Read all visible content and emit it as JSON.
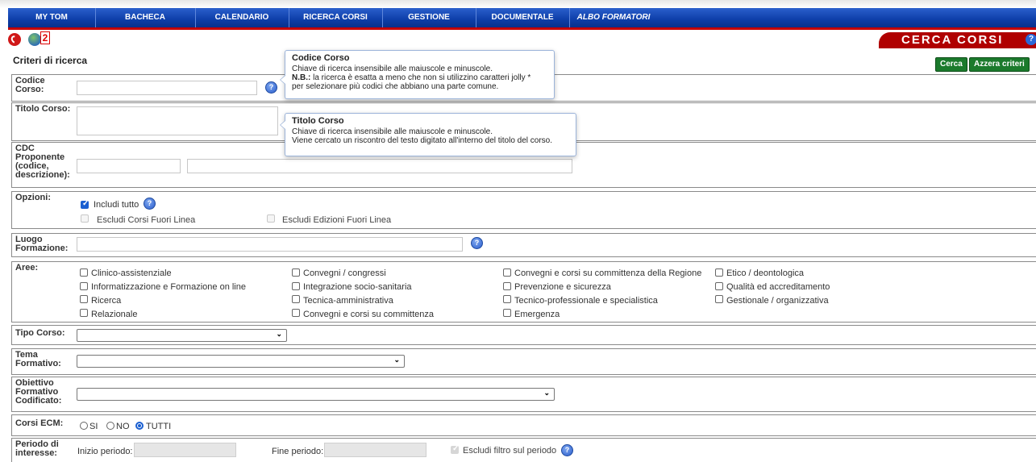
{
  "nav": {
    "items": [
      "MY TOM",
      "BACHECA",
      "CALENDARIO",
      "RICERCA CORSI",
      "GESTIONE",
      "DOCUMENTALE",
      "ALBO FORMATORI"
    ]
  },
  "header": {
    "notification_count": "2",
    "page_title": "CERCA CORSI",
    "section_title": "Criteri di ricerca",
    "search_label": "Cerca",
    "reset_label": "Azzera criteri"
  },
  "fields": {
    "codice": {
      "label": "Codice Corso:",
      "value": ""
    },
    "titolo": {
      "label": "Titolo Corso:",
      "value": ""
    },
    "cdc": {
      "label": "CDC Proponente (codice, descrizione):",
      "code_value": "",
      "desc_value": ""
    },
    "opzioni": {
      "label": "Opzioni:",
      "includi_tutto": "Includi tutto",
      "escludi_corsi": "Escludi Corsi Fuori Linea",
      "escludi_edizioni": "Escludi Edizioni Fuori Linea"
    },
    "luogo": {
      "label": "Luogo Formazione:",
      "value": ""
    },
    "aree": {
      "label": "Aree:",
      "items": [
        "Clinico-assistenziale",
        "Convegni / congressi",
        "Convegni e corsi su committenza della Regione",
        "Etico / deontologica",
        "Informatizzazione e Formazione on line",
        "Integrazione socio-sanitaria",
        "Prevenzione e sicurezza",
        "Qualità ed accreditamento",
        "Ricerca",
        "Tecnica-amministrativa",
        "Tecnico-professionale e specialistica",
        "Gestionale / organizzativa",
        "Relazionale",
        "Convegni e corsi su committenza",
        "Emergenza"
      ]
    },
    "tipo": {
      "label": "Tipo Corso:",
      "selected": ""
    },
    "tema": {
      "label": "Tema Formativo:",
      "selected": ""
    },
    "obiettivo": {
      "label": "Obiettivo Formativo Codificato:",
      "selected": ""
    },
    "ecm": {
      "label": "Corsi ECM:",
      "options": [
        "SI",
        "NO",
        "TUTTI"
      ],
      "selected": "TUTTI"
    },
    "periodo": {
      "label": "Periodo di interesse:",
      "inizio_label": "Inizio periodo:",
      "fine_label": "Fine periodo:",
      "escludi_label": "Escludi filtro sul periodo"
    }
  },
  "tooltips": {
    "codice": {
      "title": "Codice Corso",
      "line1": "Chiave di ricerca insensibile alle maiuscole e minuscole.",
      "nb_label": "N.B.:",
      "line2": "la ricerca è esatta a meno che non si utilizzino caratteri jolly *",
      "line3": "per selezionare più codici che abbiano una parte comune."
    },
    "titolo": {
      "title": "Titolo Corso",
      "line1": "Chiave di ricerca insensibile alle maiuscole e minuscole.",
      "line2": "Viene cercato un riscontro del testo digitato all'interno del titolo del corso."
    }
  },
  "colors": {
    "nav": "#0d3ea8",
    "accent_red": "#b00000",
    "button_green": "#1b7a2c",
    "checkbox_blue": "#1a5fd1"
  },
  "icons": [
    "phone-icon",
    "globe-icon",
    "help-icon",
    "chevron-down-icon"
  ]
}
